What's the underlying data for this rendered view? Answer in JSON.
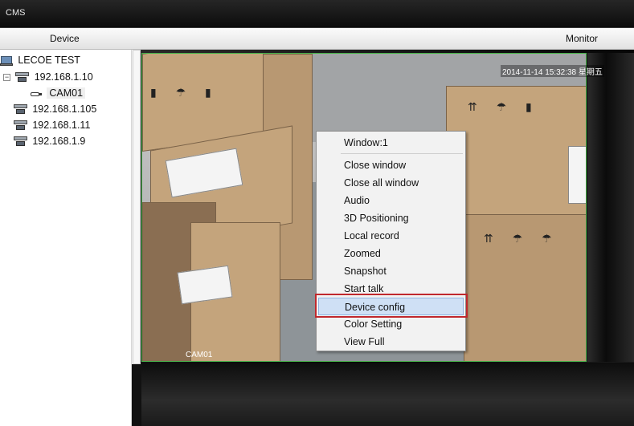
{
  "window": {
    "title": "CMS"
  },
  "header": {
    "device_label": "Device",
    "monitor_label": "Monitor"
  },
  "tree": {
    "root": "LECOE TEST",
    "devices": [
      {
        "label": "192.168.1.10",
        "expanded": true,
        "children": [
          "CAM01"
        ]
      },
      {
        "label": "192.168.1.105"
      },
      {
        "label": "192.168.1.11"
      },
      {
        "label": "192.168.1.9"
      }
    ]
  },
  "video": {
    "timestamp": "2014-11-14 15:32:38 星期五",
    "camera_label": "CAM01"
  },
  "context_menu": {
    "header": "Window:1",
    "items": [
      "Close window",
      "Close all window",
      "Audio",
      "3D Positioning",
      "Local record",
      "Zoomed",
      "Snapshot",
      "Start talk",
      "Device config",
      "Color Setting",
      "View Full"
    ],
    "highlighted": "Device config"
  },
  "colors": {
    "video_border": "#48b24a",
    "highlight_outline": "#c0282d",
    "menu_hover": "#cfe0f5"
  }
}
